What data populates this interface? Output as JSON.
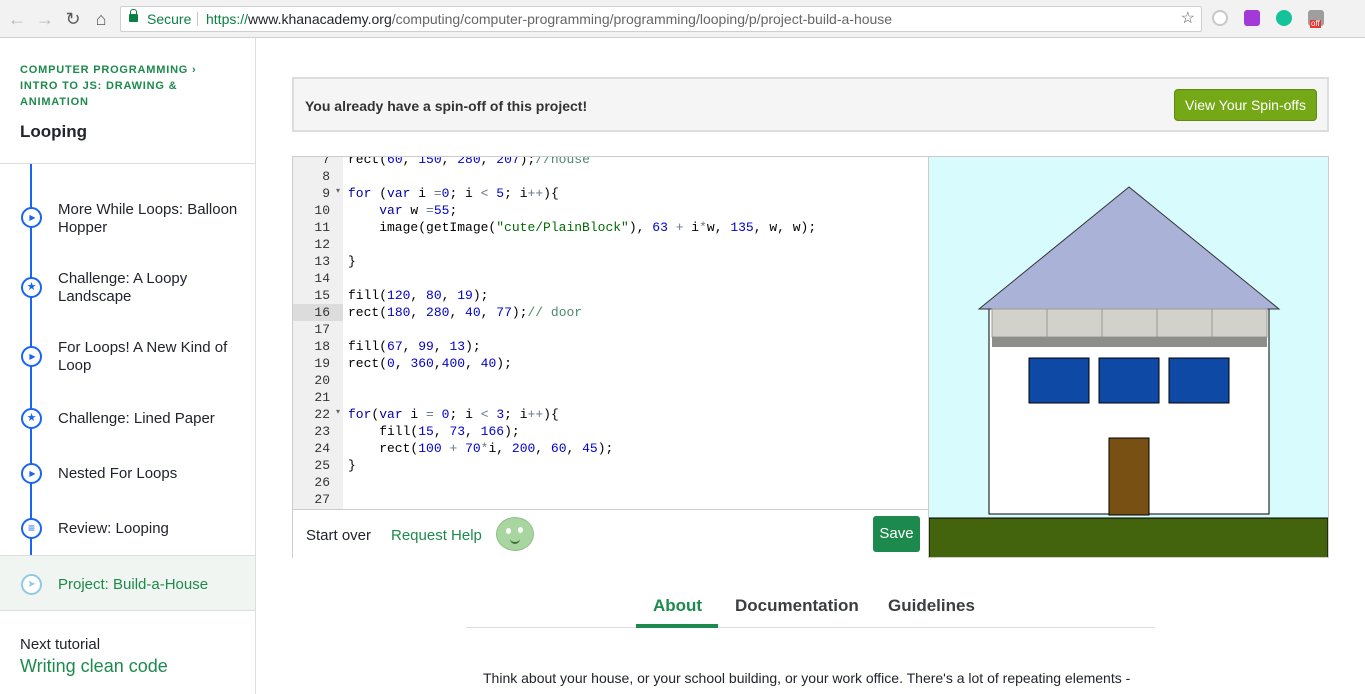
{
  "browser": {
    "secure_label": "Secure",
    "url_scheme": "https://",
    "url_host": "www.khanacademy.org",
    "url_path": "/computing/computer-programming/programming/looping/p/project-build-a-house",
    "extension_badge": "off"
  },
  "sidebar": {
    "crumb_primary": "COMPUTER PROGRAMMING",
    "crumb_secondary_1": "INTRO TO JS: DRAWING &",
    "crumb_secondary_2": "ANIMATION",
    "topic_title": "Looping",
    "items": [
      {
        "label": "More While Loops: Balloon Hopper",
        "icon": "play-icon"
      },
      {
        "label": "Challenge: A Loopy Landscape",
        "icon": "star-icon"
      },
      {
        "label": "For Loops! A New Kind of Loop",
        "icon": "play-icon"
      },
      {
        "label": "Challenge: Lined Paper",
        "icon": "star-icon"
      },
      {
        "label": "Nested For Loops",
        "icon": "play-icon"
      },
      {
        "label": "Review: Looping",
        "icon": "document-icon"
      },
      {
        "label": "Project: Build-a-House",
        "icon": "rocket-icon"
      }
    ],
    "next_label": "Next tutorial",
    "next_link": "Writing clean code"
  },
  "spinoff": {
    "message": "You already have a spin-off of this project!",
    "button": "View Your Spin-offs"
  },
  "editor": {
    "highlighted_line": 16,
    "lines": [
      {
        "n": "7",
        "code": "rect(60, 150, 280, 207);//house"
      },
      {
        "n": "8",
        "code": ""
      },
      {
        "n": "9",
        "code": "for (var i =0; i < 5; i++){",
        "fold": true
      },
      {
        "n": "10",
        "code": "    var w =55;"
      },
      {
        "n": "11",
        "code": "    image(getImage(\"cute/PlainBlock\"), 63 + i*w, 135, w, w);"
      },
      {
        "n": "12",
        "code": ""
      },
      {
        "n": "13",
        "code": "}"
      },
      {
        "n": "14",
        "code": ""
      },
      {
        "n": "15",
        "code": "fill(120, 80, 19);"
      },
      {
        "n": "16",
        "code": "rect(180, 280, 40, 77);// door"
      },
      {
        "n": "17",
        "code": ""
      },
      {
        "n": "18",
        "code": "fill(67, 99, 13);"
      },
      {
        "n": "19",
        "code": "rect(0, 360,400, 40);"
      },
      {
        "n": "20",
        "code": ""
      },
      {
        "n": "21",
        "code": ""
      },
      {
        "n": "22",
        "code": "for(var i = 0; i < 3; i++){",
        "fold": true
      },
      {
        "n": "23",
        "code": "    fill(15, 73, 166);"
      },
      {
        "n": "24",
        "code": "    rect(100 + 70*i, 200, 60, 45);"
      },
      {
        "n": "25",
        "code": "}"
      },
      {
        "n": "26",
        "code": ""
      },
      {
        "n": "27",
        "code": ""
      }
    ],
    "start_over": "Start over",
    "request_help": "Request Help",
    "save": "Save"
  },
  "output_colors": {
    "sky": "#d8fcfd",
    "roof": "#aab2d8",
    "house": "#ffffff",
    "blocks": "#d2d2ca",
    "window": "#0f49a6",
    "door": "#785013",
    "ground": "#43630d"
  },
  "tabs": {
    "about": "About",
    "documentation": "Documentation",
    "guidelines": "Guidelines"
  },
  "description": "Think about your house, or your school building, or your work office. There's a lot of repeating elements -"
}
